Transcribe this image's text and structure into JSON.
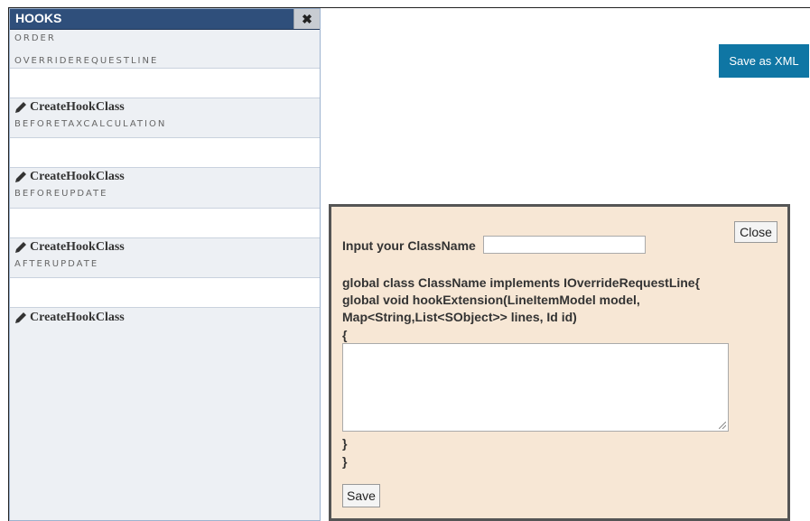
{
  "hooks": {
    "title": "HOOKS",
    "close_icon": "close-x-icon",
    "section_order": "ORDER",
    "items": [
      {
        "label": "OVERRIDEREQUESTLINE",
        "value": "",
        "link": "CreateHookClass"
      },
      {
        "label": "BEFORETAXCALCULATION",
        "value": "",
        "link": "CreateHookClass"
      },
      {
        "label": "BEFOREUPDATE",
        "value": "",
        "link": "CreateHookClass"
      },
      {
        "label": "AFTERUPDATE",
        "value": "",
        "link": "CreateHookClass"
      }
    ]
  },
  "toolbar": {
    "save_xml_label": "Save as XML"
  },
  "modal": {
    "close_label": "Close",
    "input_label": "Input your ClassName",
    "classname_value": "",
    "code_line1": "global class ClassName implements IOverrideRequestLine{",
    "code_line2": "global void hookExtension(LineItemModel model,",
    "code_line3": "Map<String,List<SObject>> lines, Id id)",
    "open_brace": "{",
    "body_value": "",
    "close_brace1": "}",
    "close_brace2": "}",
    "save_label": "Save"
  },
  "colors": {
    "header": "#2f4f7b",
    "save_xml_bg": "#0f76a4",
    "modal_bg": "#f7e7d5",
    "panel_bg": "#edf0f4"
  }
}
